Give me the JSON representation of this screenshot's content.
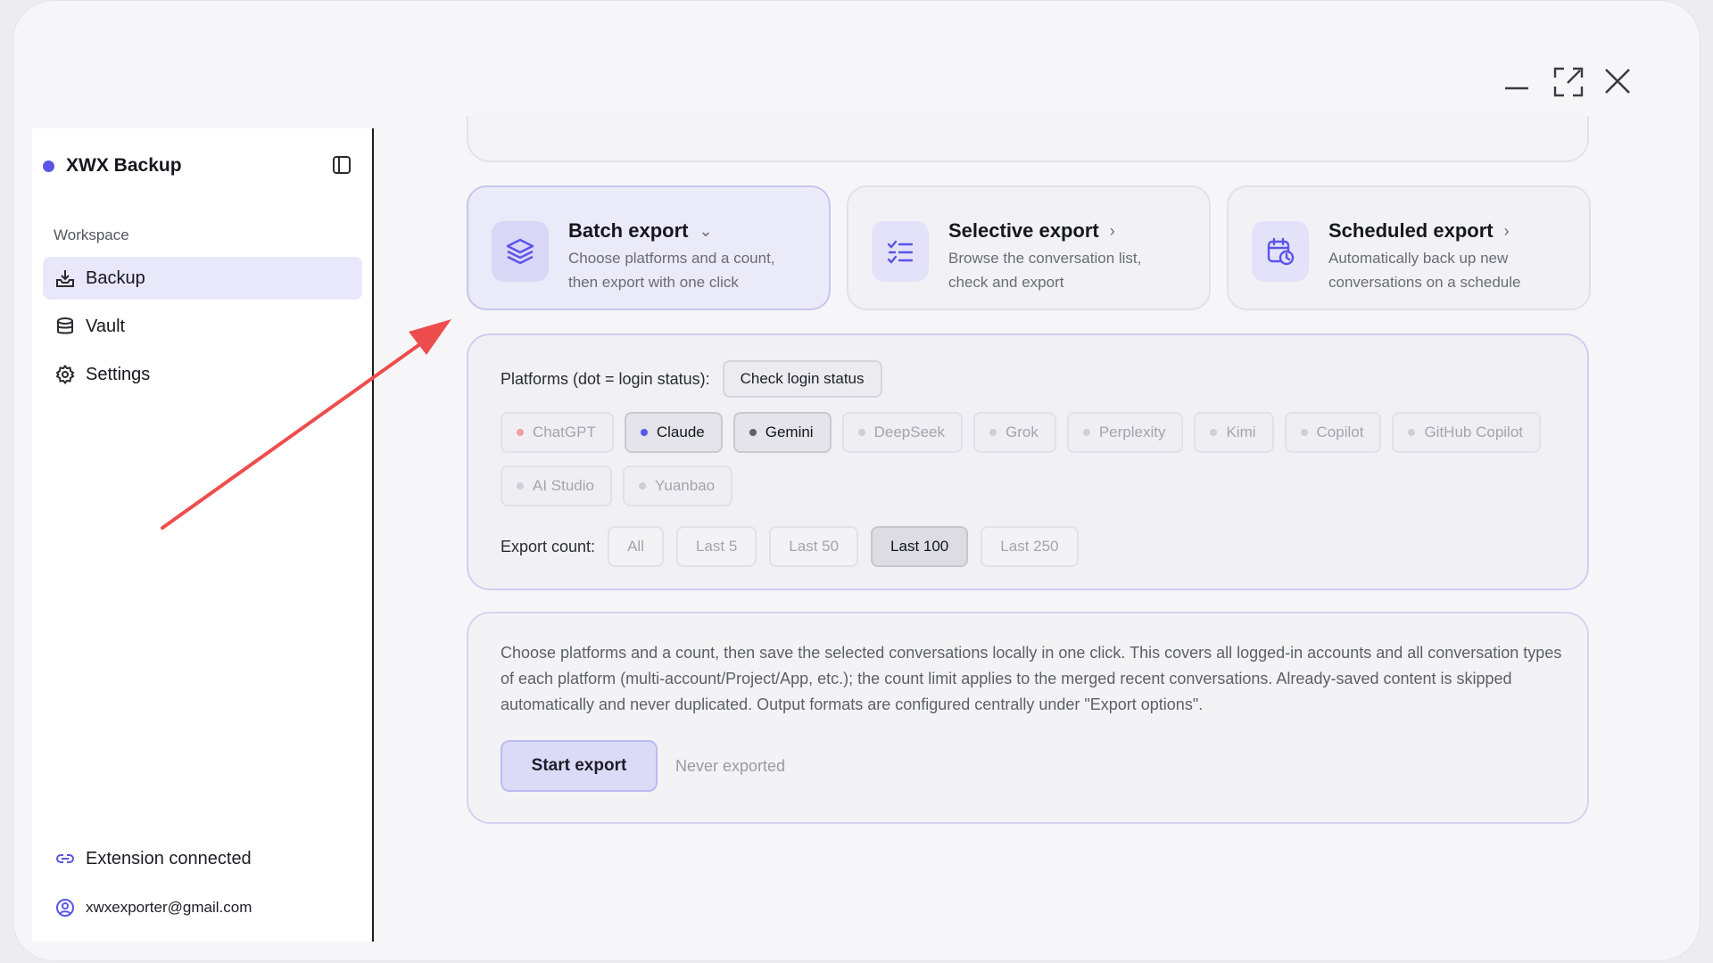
{
  "window": {
    "controls": {
      "minimize": "minimize-icon",
      "maximize": "expand-icon",
      "close": "close-icon"
    }
  },
  "sidebar": {
    "brand": "XWX Backup",
    "brand_color": "#5a55e6",
    "section_label": "Workspace",
    "items": [
      {
        "label": "Backup",
        "icon": "download-tray-icon",
        "active": true
      },
      {
        "label": "Vault",
        "icon": "database-icon",
        "active": false
      },
      {
        "label": "Settings",
        "icon": "gear-icon",
        "active": false
      }
    ],
    "footer": {
      "extension_status": "Extension connected",
      "account_email": "xwxexporter@gmail.com"
    }
  },
  "modes": [
    {
      "title": "Batch export",
      "desc_line1": "Choose platforms and a count,",
      "desc_line2": "then export with one click",
      "icon": "layers-icon",
      "active": true
    },
    {
      "title": "Selective export",
      "desc_line1": "Browse the conversation list,",
      "desc_line2": "check and export",
      "icon": "checklist-icon",
      "active": false
    },
    {
      "title": "Scheduled export",
      "desc_line1": "Automatically back up new",
      "desc_line2": "conversations on a schedule",
      "icon": "calendar-clock-icon",
      "active": false
    }
  ],
  "platforms": {
    "label": "Platforms (dot = login status):",
    "check_button": "Check login status",
    "items": [
      {
        "name": "ChatGPT",
        "selected": false
      },
      {
        "name": "Claude",
        "selected": true
      },
      {
        "name": "Gemini",
        "selected": true
      },
      {
        "name": "DeepSeek",
        "selected": false
      },
      {
        "name": "Grok",
        "selected": false
      },
      {
        "name": "Perplexity",
        "selected": false
      },
      {
        "name": "Kimi",
        "selected": false
      },
      {
        "name": "Copilot",
        "selected": false
      },
      {
        "name": "GitHub Copilot",
        "selected": false
      },
      {
        "name": "AI Studio",
        "selected": false
      },
      {
        "name": "Yuanbao",
        "selected": false
      }
    ]
  },
  "export_count": {
    "label": "Export count:",
    "options": [
      "All",
      "Last 5",
      "Last 50",
      "Last 100",
      "Last 250"
    ],
    "selected": "Last 100"
  },
  "info": {
    "description": "Choose platforms and a count, then save the selected conversations locally in one click. This covers all logged-in accounts and all conversation types of each platform (multi-account/Project/App, etc.); the count limit applies to the merged recent conversations. Already-saved content is skipped automatically and never duplicated. Output formats are configured centrally under \"Export options\".",
    "start_button": "Start export",
    "status": "Never exported"
  },
  "annotation": {
    "arrow_color": "#ee4d4d"
  }
}
